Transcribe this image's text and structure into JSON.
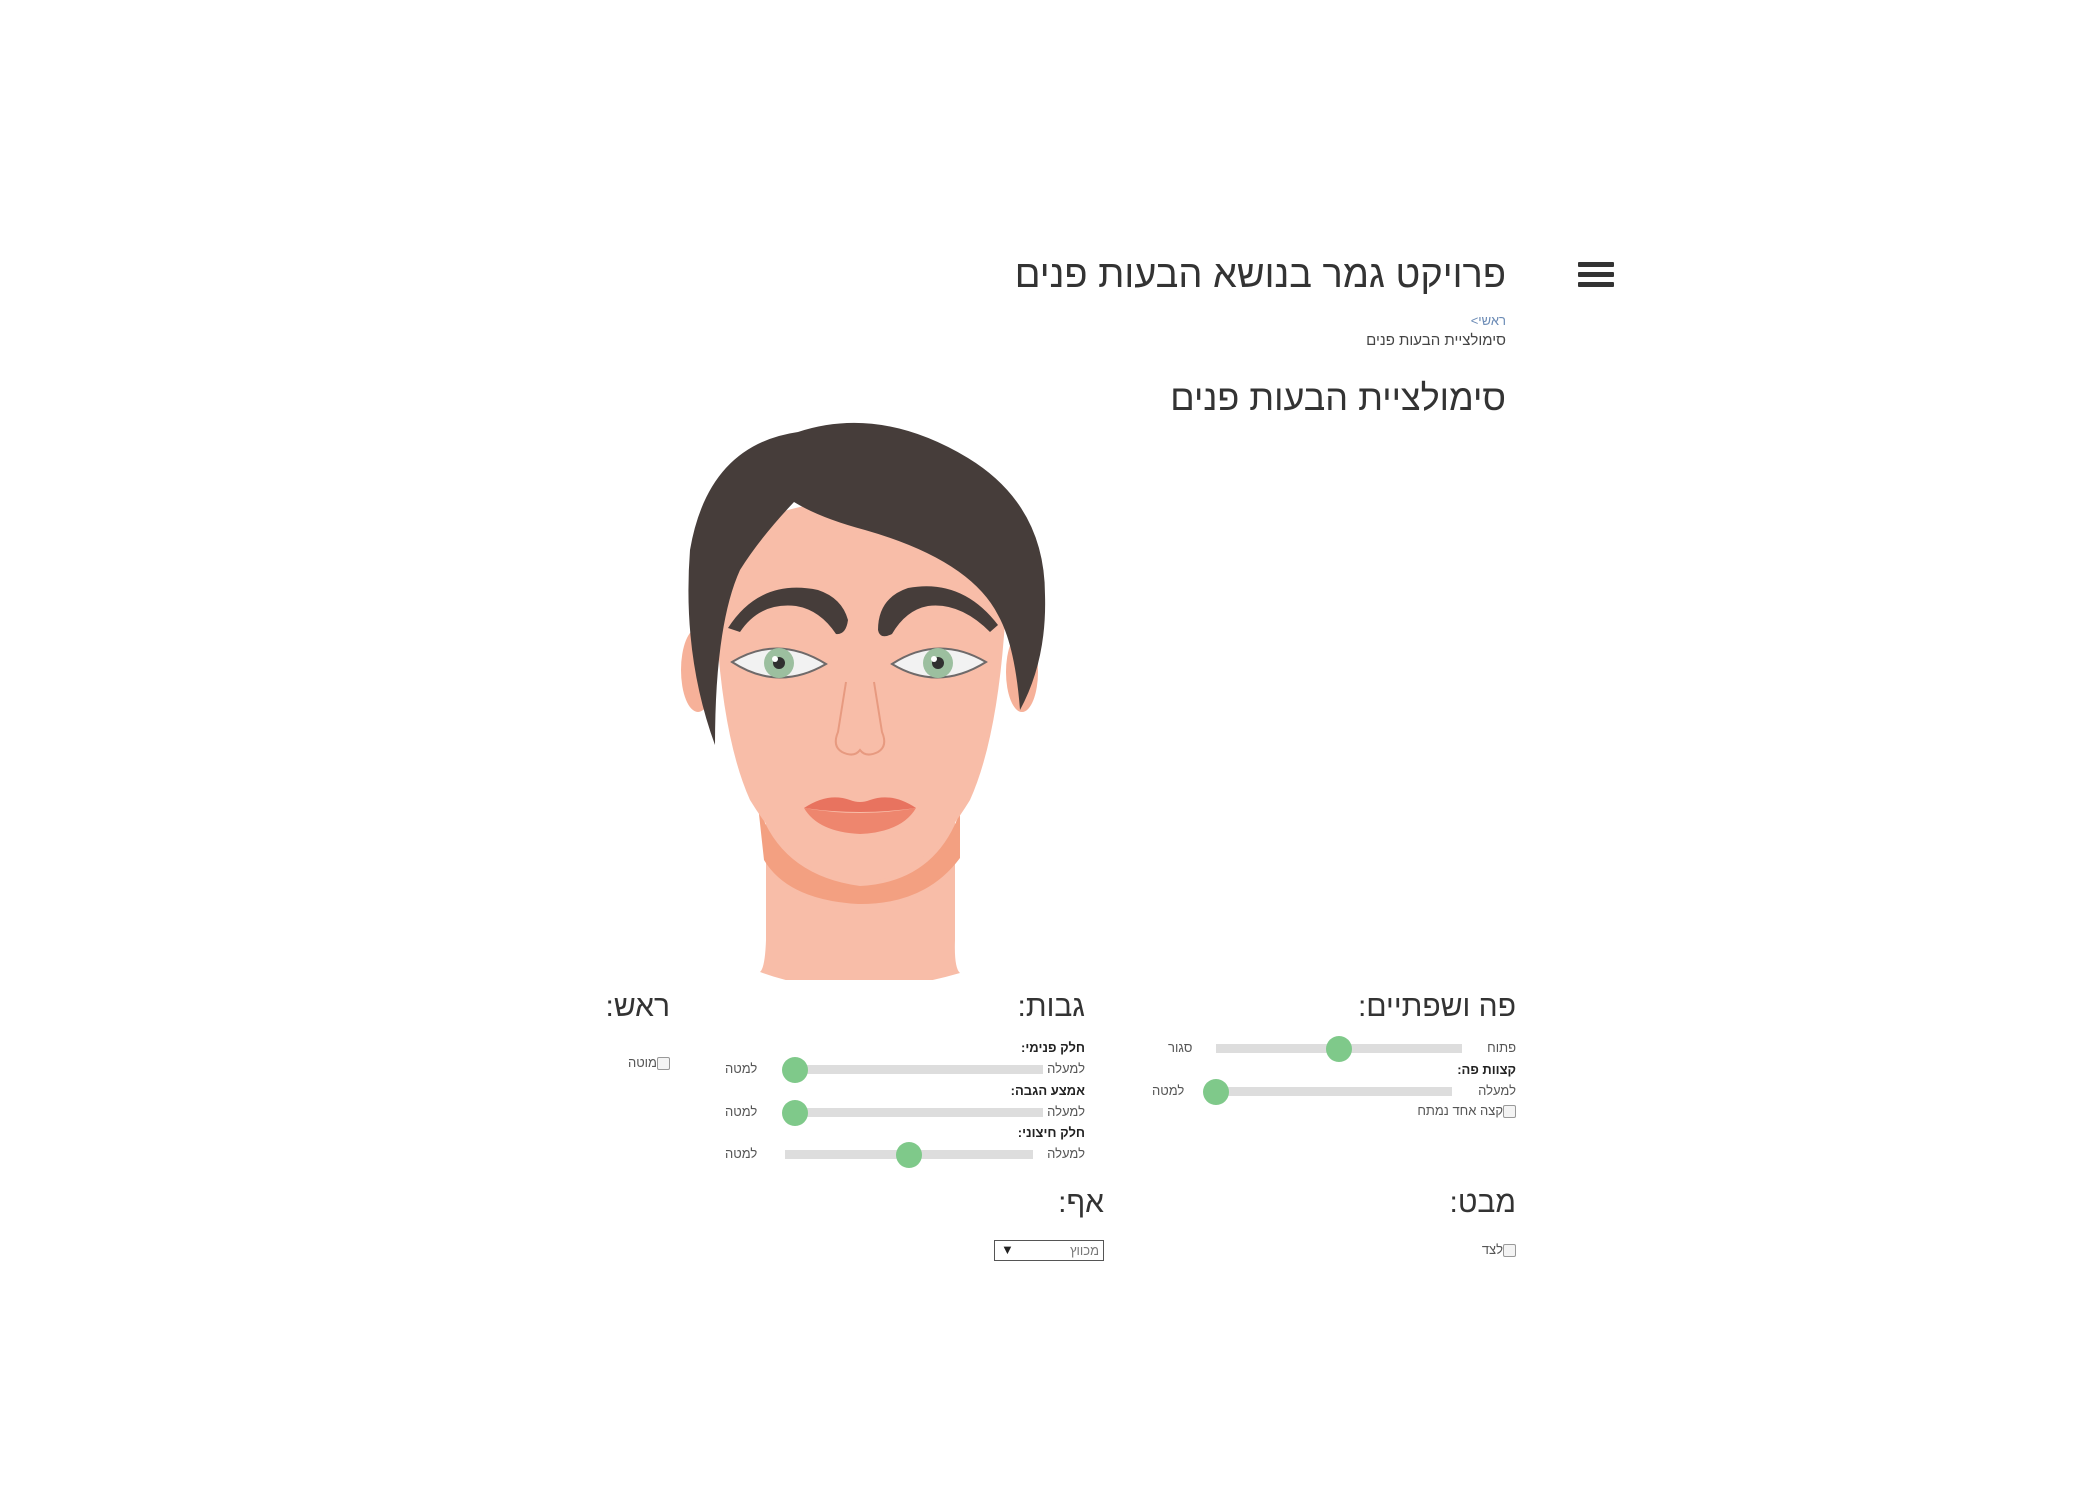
{
  "header": {
    "site_title": "פרויקט גמר בנושא הבעות פנים",
    "breadcrumb_home": "ראשי>",
    "breadcrumb_current": "סימולציית הבעות פנים",
    "menu_icon": "hamburger-menu-icon"
  },
  "page_title": "סימולציית הבעות פנים",
  "colors": {
    "hair": "#463d3a",
    "skin": "#f8bda8",
    "skin_shadow": "#f3a081",
    "eye_iris": "#9cbf9f",
    "lips": "#e66a55",
    "slider_thumb": "#7fc98a",
    "slider_track": "#dddddd"
  },
  "mouth": {
    "heading": "פה ושפתיים:",
    "open_slider": {
      "left_label": "סגור",
      "right_label": "פתוח",
      "value": 0.5
    },
    "corners_label": "קצוות פה:",
    "corners_slider": {
      "left_label": "למטה",
      "right_label": "למעלה",
      "value": 0.0
    },
    "one_side_checkbox": {
      "label": "קצה אחד נמתח",
      "checked": false
    }
  },
  "eyebrows": {
    "heading": "גבות:",
    "sliders": [
      {
        "name": "חלק פנימי:",
        "left_label": "למטה",
        "right_label": "למעלה",
        "value": 0.0
      },
      {
        "name": "אמצע הגבה:",
        "left_label": "למטה",
        "right_label": "למעלה",
        "value": 0.0
      },
      {
        "name": "חלק חיצוני:",
        "left_label": "למטה",
        "right_label": "למעלה",
        "value": 0.5
      }
    ]
  },
  "head": {
    "heading": "ראש:",
    "tilt_checkbox": {
      "label": "מוטה",
      "checked": false
    }
  },
  "gaze": {
    "heading": "מבט:",
    "side_checkbox": {
      "label": "לצד",
      "checked": false
    }
  },
  "nose": {
    "heading": "אף:",
    "select_value": "מכווץ",
    "select_arrow": "▼"
  }
}
